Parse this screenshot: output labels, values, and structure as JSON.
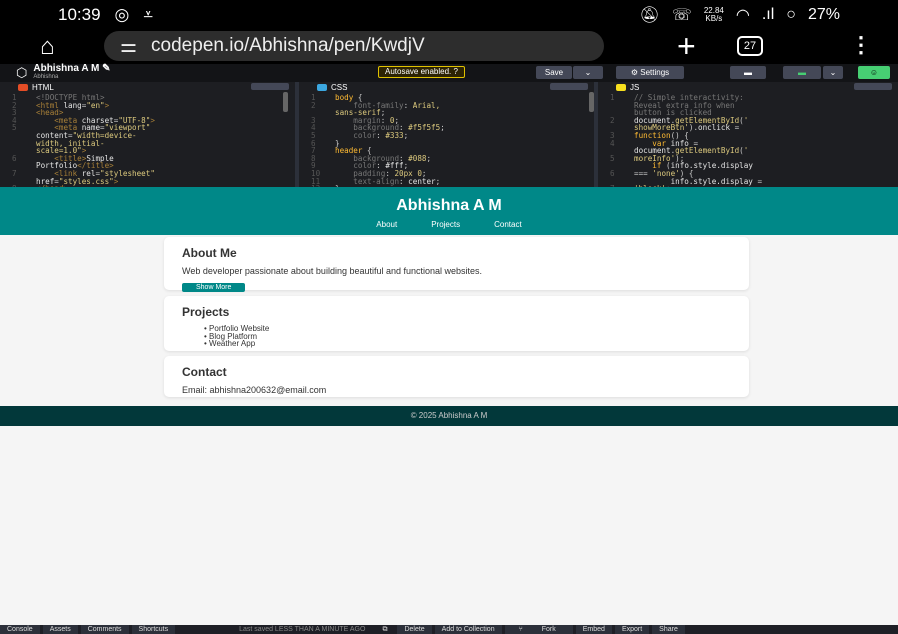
{
  "status": {
    "time": "10:39",
    "net_rate": "22.84",
    "net_unit": "KB/s",
    "battery": "27%"
  },
  "browser": {
    "url": "codepen.io/Abhishna/pen/KwdjV",
    "tab_count": "27"
  },
  "codepen": {
    "user_name": "Abhishna A M",
    "user_handle": "Abhishna",
    "autosave": "Autosave enabled. ?",
    "save_label": "Save",
    "settings_label": "Settings",
    "editors": {
      "html": {
        "label": "HTML",
        "color": "#e44d26"
      },
      "css": {
        "label": "CSS",
        "color": "#3ba7e0"
      },
      "js": {
        "label": "JS",
        "color": "#f7df1e"
      }
    },
    "footer": {
      "console": "Console",
      "assets": "Assets",
      "comments": "Comments",
      "shortcuts": "Shortcuts",
      "last_saved": "Last saved LESS THAN A MINUTE AGO",
      "delete": "Delete",
      "add_to_collection": "Add to Collection",
      "fork": "Fork",
      "embed": "Embed",
      "export": "Export",
      "share": "Share"
    }
  },
  "preview": {
    "title": "Abhishna A M",
    "nav": [
      "About",
      "Projects",
      "Contact"
    ],
    "about": {
      "heading": "About Me",
      "text": "Web developer passionate about building beautiful and functional websites.",
      "button": "Show More"
    },
    "projects": {
      "heading": "Projects",
      "items": [
        "Portfolio Website",
        "Blog Platform",
        "Weather App"
      ]
    },
    "contact": {
      "heading": "Contact",
      "email": "Email: abhishna200632@email.com"
    },
    "footer": "© 2025 Abhishna A M"
  }
}
